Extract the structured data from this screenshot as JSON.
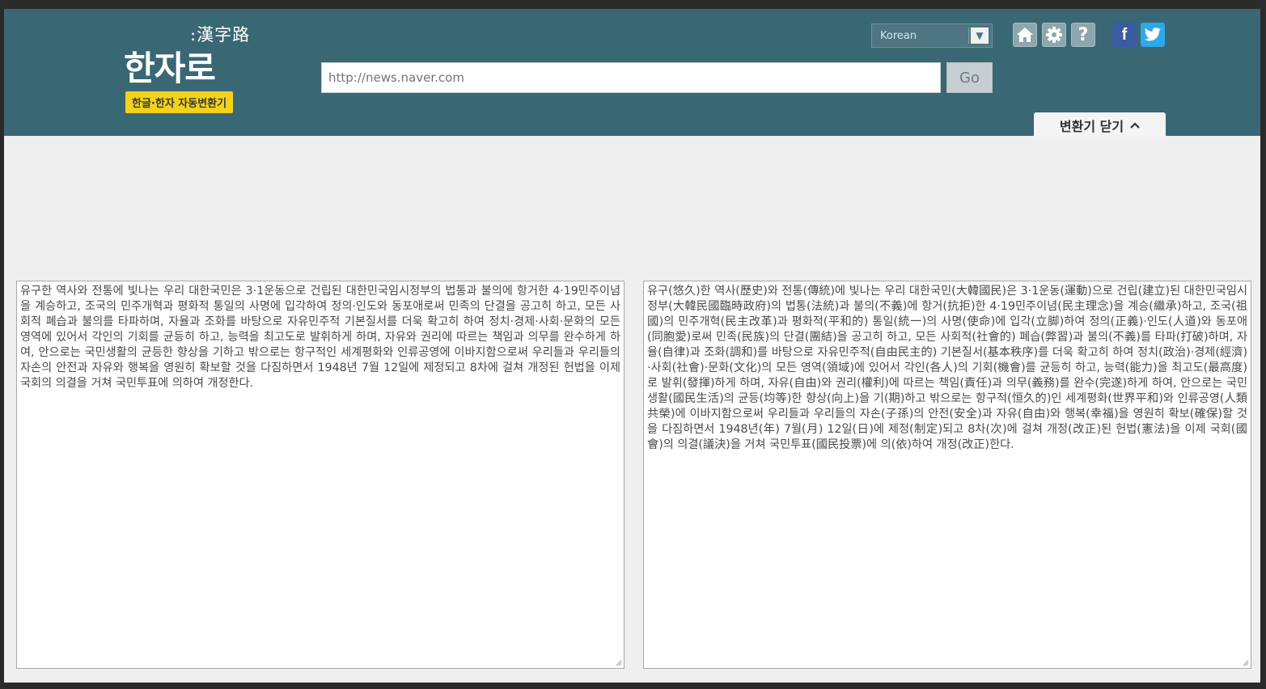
{
  "logo": {
    "hanja": ":漢字路",
    "title": "한자로",
    "badge": "한글·한자 자동변환기"
  },
  "search": {
    "placeholder": "http://news.naver.com",
    "go_label": "Go"
  },
  "language": {
    "selected": "Korean"
  },
  "toolbar": {
    "icons": [
      "home-icon",
      "gear-icon",
      "help-icon",
      "facebook-icon",
      "twitter-icon"
    ],
    "help_glyph": "?",
    "facebook_glyph": "f"
  },
  "converter": {
    "close_label": "변환기 닫기"
  },
  "panels": {
    "input_text": " 유구한 역사와 전통에 빛나는 우리 대한국민은 3·1운동으로 건립된 대한민국임시정부의 법통과 불의에 항거한 4·19민주이념을 계승하고, 조국의 민주개혁과 평화적 통일의 사명에 입각하여 정의·인도와 동포애로써 민족의 단결을 공고히 하고, 모든 사회적 폐습과 불의를 타파하며, 자율과 조화를 바탕으로 자유민주적 기본질서를 더욱 확고히 하여 정치·경제·사회·문화의 모든 영역에 있어서 각인의 기회를 균등히 하고, 능력을 최고도로 발휘하게 하며, 자유와 권리에 따르는 책임과 의무를 완수하게 하여, 안으로는 국민생활의 균등한 향상을 기하고 밖으로는 항구적인 세계평화와 인류공영에 이바지함으로써 우리들과 우리들의 자손의 안전과 자유와 행복을 영원히 확보할 것을 다짐하면서 1948년 7월 12일에 제정되고 8차에 걸쳐 개정된 헌법을 이제 국회의 의결을 거쳐 국민투표에 의하여 개정한다.",
    "output_text": " 유구(悠久)한 역사(歷史)와 전통(傳統)에 빛나는 우리 대한국민(大韓國民)은 3·1운동(運動)으로 건립(建立)된 대한민국임시정부(大韓民國臨時政府)의 법통(法統)과 불의(不義)에 항거(抗拒)한 4·19민주이념(民主理念)을 계승(繼承)하고, 조국(祖國)의 민주개혁(民主改革)과 평화적(平和的) 통일(統一)의 사명(使命)에 입각(立脚)하여 정의(正義)·인도(人道)와 동포애(同胞愛)로써 민족(民族)의 단결(團結)을 공고히 하고, 모든 사회적(社會的) 폐습(弊習)과 불의(不義)를 타파(打破)하며, 자율(自律)과 조화(調和)를 바탕으로 자유민주적(自由民主的) 기본질서(基本秩序)를 더욱 확고히 하여 정치(政治)·경제(經濟)·사회(社會)·문화(文化)의 모든 영역(領域)에 있어서 각인(各人)의 기회(機會)를 균등히 하고, 능력(能力)을 최고도(最高度)로 발휘(發揮)하게 하며, 자유(自由)와 권리(權利)에 따르는 책임(責任)과 의무(義務)를 완수(完遂)하게 하여, 안으로는 국민생활(國民生活)의 균등(均等)한 향상(向上)을 기(期)하고 밖으로는 항구적(恒久的)인 세계평화(世界平和)와 인류공영(人類共榮)에 이바지함으로써 우리들과 우리들의 자손(子孫)의 안전(安全)과 자유(自由)와 행복(幸福)을 영원히 확보(確保)할 것을 다짐하면서 1948년(年) 7월(月) 12일(日)에 제정(制定)되고 8차(次)에 걸쳐 개정(改正)된 헌법(憲法)을 이제 국회(國會)의 의결(議決)을 거쳐 국민투표(國民投票)에 의(依)하여 개정(改正)한다."
  },
  "colors": {
    "header_bg": "#3a6774",
    "badge_bg": "#f2d21b",
    "facebook": "#3b5ba0",
    "twitter": "#2ea8e8"
  }
}
